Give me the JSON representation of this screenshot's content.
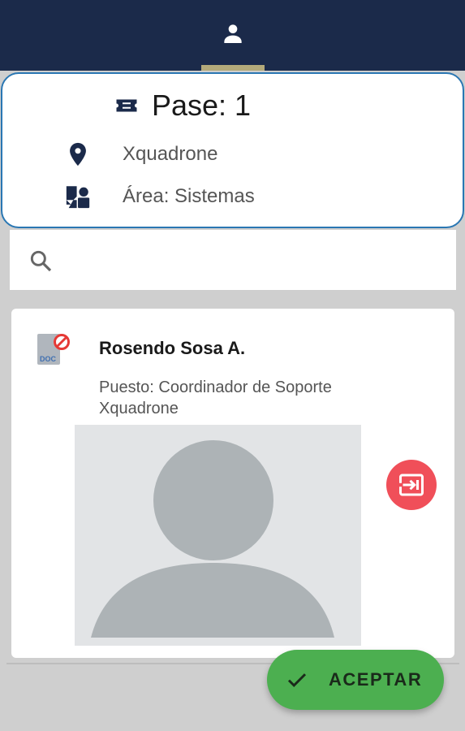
{
  "header": {
    "tab_icon": "person-icon",
    "indicator_color": "#b3a97a",
    "bar_color": "#1b2a4a"
  },
  "pass": {
    "title": "Pase: 1",
    "location": "Xquadrone",
    "area": "Área: Sistemas",
    "icons": [
      "ticket-icon",
      "location-pin-icon",
      "area-icon"
    ]
  },
  "search": {
    "placeholder": "",
    "value": "",
    "icon": "search-icon"
  },
  "person": {
    "name": "Rosendo Sosa A.",
    "role": "Puesto: Coordinador de Soporte Xquadrone",
    "doc_icon": "doc-blocked-icon",
    "doc_label": "DOC",
    "photo": "avatar-placeholder",
    "exit_icon": "exit-icon",
    "exit_color": "#f04f59"
  },
  "actions": {
    "accept_label": "ACEPTAR",
    "accept_color": "#4caf50"
  }
}
